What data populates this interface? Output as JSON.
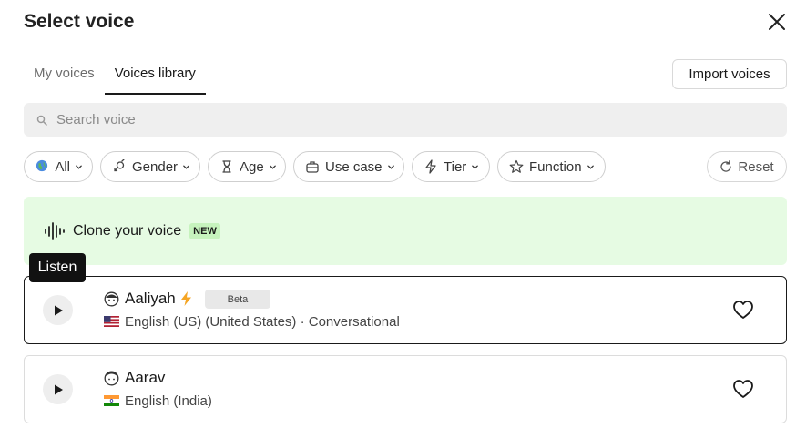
{
  "dialog": {
    "title": "Select voice"
  },
  "tabs": [
    {
      "label": "My voices",
      "active": false
    },
    {
      "label": "Voices library",
      "active": true
    }
  ],
  "import_button": "Import voices",
  "search": {
    "placeholder": "Search voice",
    "value": ""
  },
  "filters": [
    {
      "label": "All",
      "icon": "globe-icon"
    },
    {
      "label": "Gender",
      "icon": "gender-icon"
    },
    {
      "label": "Age",
      "icon": "hourglass-icon"
    },
    {
      "label": "Use case",
      "icon": "briefcase-icon"
    },
    {
      "label": "Tier",
      "icon": "zap-icon"
    },
    {
      "label": "Function",
      "icon": "star-icon"
    }
  ],
  "reset_label": "Reset",
  "clone": {
    "label": "Clone your voice",
    "badge": "NEW"
  },
  "tooltip": "Listen",
  "voices": [
    {
      "name": "Aaliyah",
      "badge": "Beta",
      "flag": "US",
      "description": "English (US) (United States) · Conversational",
      "selected": true
    },
    {
      "name": "Aarav",
      "flag": "IN",
      "description": "English (India)",
      "selected": false
    }
  ],
  "colors": {
    "clone_bg": "#e6fbe3",
    "new_badge_bg": "#c6f3bd",
    "bolt": "#f5a524",
    "tooltip_bg": "#111111"
  }
}
